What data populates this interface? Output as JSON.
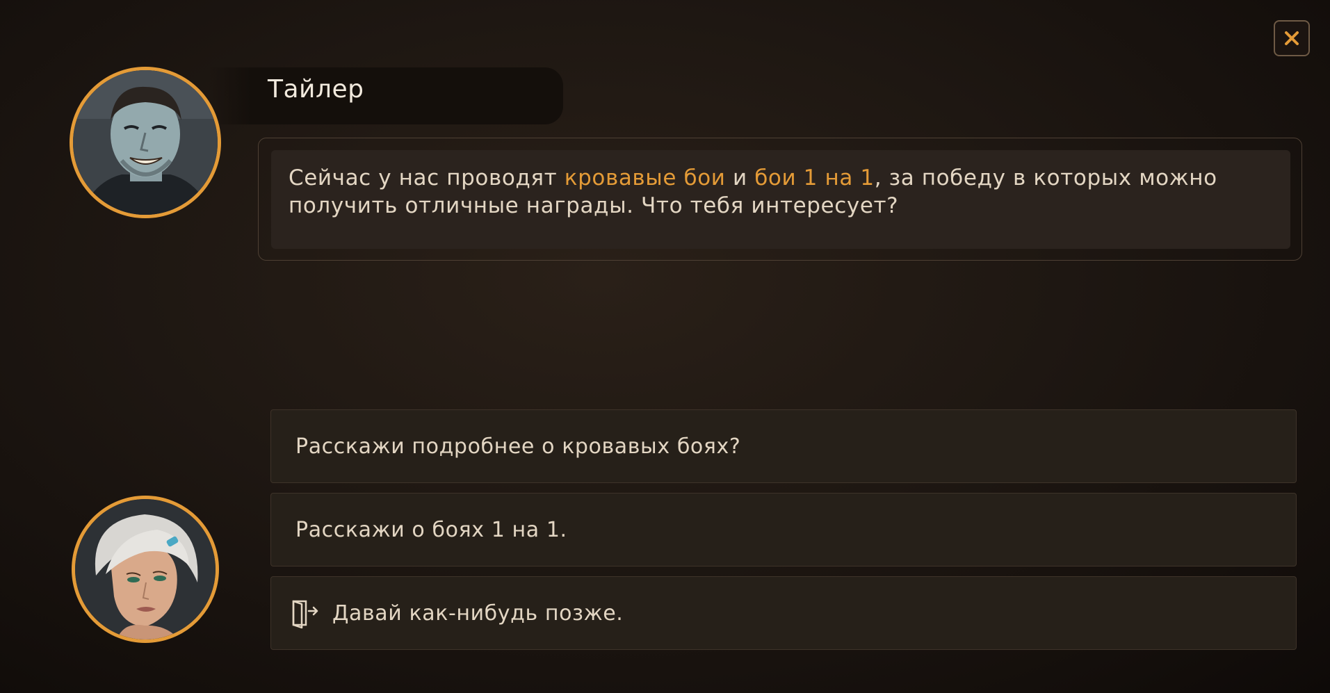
{
  "dialog": {
    "speaker_name": "Тайлер",
    "message": {
      "part1": "Сейчас у нас проводят ",
      "highlight1": "кровавые бои",
      "part2": " и ",
      "highlight2": "бои 1 на 1",
      "part3": ", за победу в которых можно получить отличные награды. Что тебя интересует?"
    },
    "options": [
      {
        "label": "Расскажи подробнее о кровавых боях?"
      },
      {
        "label": "Расскажи о боях 1 на 1."
      },
      {
        "label": "Давай как-нибудь позже.",
        "icon": "exit-door-icon"
      }
    ]
  },
  "colors": {
    "accent": "#e49b37",
    "text": "#e3d6c3",
    "background": "#1e1712",
    "option_bg": "#262019"
  },
  "icons": {
    "close": "close-icon",
    "exit": "exit-door-icon"
  }
}
